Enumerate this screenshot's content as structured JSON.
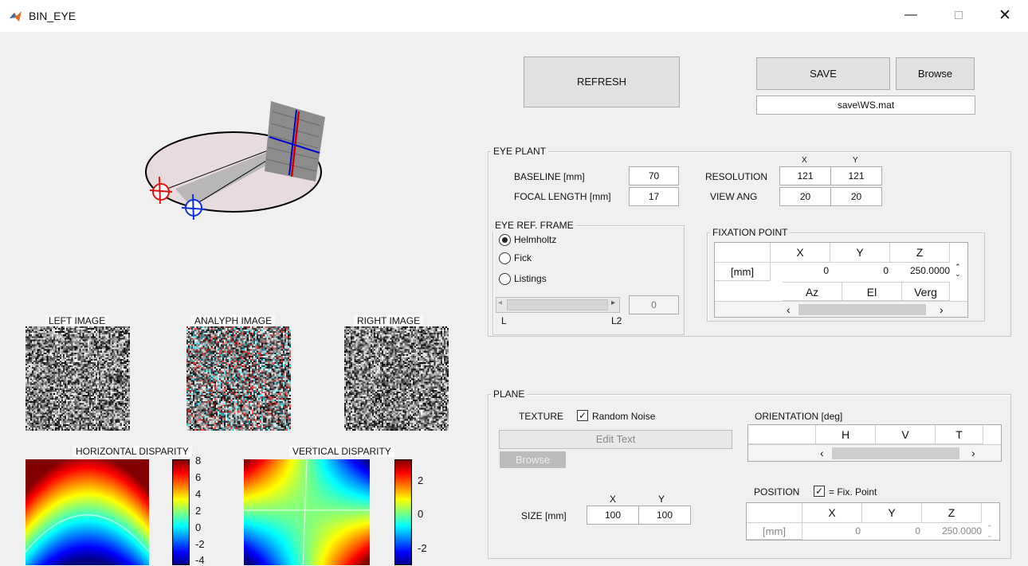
{
  "window": {
    "title": "BIN_EYE",
    "minimize": "—",
    "close": "✕"
  },
  "top_buttons": {
    "refresh": "REFRESH",
    "save": "SAVE",
    "browse": "Browse",
    "save_path": "save\\WS.mat"
  },
  "eye_plant": {
    "legend": "EYE PLANT",
    "baseline_label": "BASELINE [mm]",
    "baseline": "70",
    "focal_label": "FOCAL LENGTH [mm]",
    "focal": "17",
    "col_x": "X",
    "col_y": "Y",
    "resolution_label": "RESOLUTION",
    "res_x": "121",
    "res_y": "121",
    "viewang_label": "VIEW ANG",
    "view_x": "20",
    "view_y": "20"
  },
  "eye_ref_frame": {
    "legend": "EYE REF. FRAME",
    "options": [
      "Helmholtz",
      "Fick",
      "Listings"
    ],
    "selected": 0,
    "slider_min_label": "L",
    "slider_max_label": "L2",
    "slider_value": "0"
  },
  "fixation_point": {
    "legend": "FIXATION POINT",
    "headers": [
      "X",
      "Y",
      "Z"
    ],
    "row_label": "[mm]",
    "values": [
      "0",
      "0",
      "250.0000"
    ],
    "angle_headers": [
      "Az",
      "El",
      "Verg"
    ]
  },
  "plane": {
    "legend": "PLANE",
    "texture_label": "TEXTURE",
    "random_noise_label": "Random Noise",
    "random_noise_checked": true,
    "edit_text": "Edit Text",
    "browse": "Browse",
    "size_label": "SIZE [mm]",
    "size_col_x": "X",
    "size_col_y": "Y",
    "size_x": "100",
    "size_y": "100",
    "orientation_label": "ORIENTATION [deg]",
    "orientation_headers": [
      "H",
      "V",
      "T"
    ],
    "position_label": "POSITION",
    "fix_point_label": "= Fix. Point",
    "fix_point_checked": true,
    "position_headers": [
      "X",
      "Y",
      "Z"
    ],
    "position_row_label": "[mm]",
    "position_values": [
      "0",
      "0",
      "250.0000"
    ]
  },
  "images": {
    "left": "LEFT IMAGE",
    "anaglyph": "ANALYPH IMAGE",
    "right": "RIGHT IMAGE"
  },
  "disparity": {
    "horizontal_title": "HORIZONTAL DISPARITY",
    "horizontal_ticks": [
      "8",
      "6",
      "4",
      "2",
      "0",
      "-2",
      "-4"
    ],
    "vertical_title": "VERTICAL DISPARITY",
    "vertical_ticks": [
      "2",
      "0",
      "-2"
    ]
  },
  "colors": {
    "left_eye": "#e01010",
    "right_eye": "#1030e0",
    "accent_red": "#cc0000",
    "accent_blue": "#0000cc"
  }
}
